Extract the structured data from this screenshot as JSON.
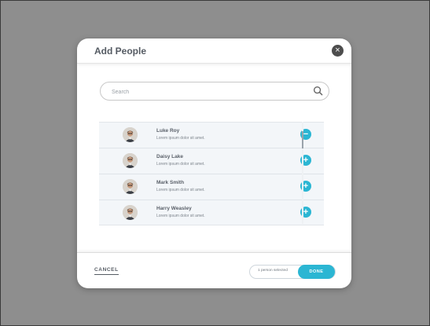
{
  "modal": {
    "title": "Add People",
    "close_icon": "close-icon"
  },
  "search": {
    "placeholder": "Search",
    "value": "",
    "icon": "search-icon"
  },
  "people": [
    {
      "name": "Luke Roy",
      "description": "Lorem ipsum dolor sit amet.",
      "action": "remove",
      "action_symbol": "−",
      "avatar": "avatar-photo"
    },
    {
      "name": "Daisy Lake",
      "description": "Lorem ipsum dolor sit amet.",
      "action": "add",
      "action_symbol": "+",
      "avatar": "avatar-photo"
    },
    {
      "name": "Mark Smith",
      "description": "Lorem ipsum dolor sit amet.",
      "action": "add",
      "action_symbol": "+",
      "avatar": "avatar-photo"
    },
    {
      "name": "Harry Weasley",
      "description": "Lorem ipsum dolor sit amet.",
      "action": "add",
      "action_symbol": "+",
      "avatar": "avatar-photo"
    }
  ],
  "footer": {
    "cancel_label": "CANCEL",
    "selected_text": "1 person selected",
    "done_label": "DONE"
  },
  "colors": {
    "accent": "#2bb6d3",
    "backdrop": "#8e8e8e",
    "title_text": "#555b63",
    "list_background": "#f3f6f9"
  }
}
